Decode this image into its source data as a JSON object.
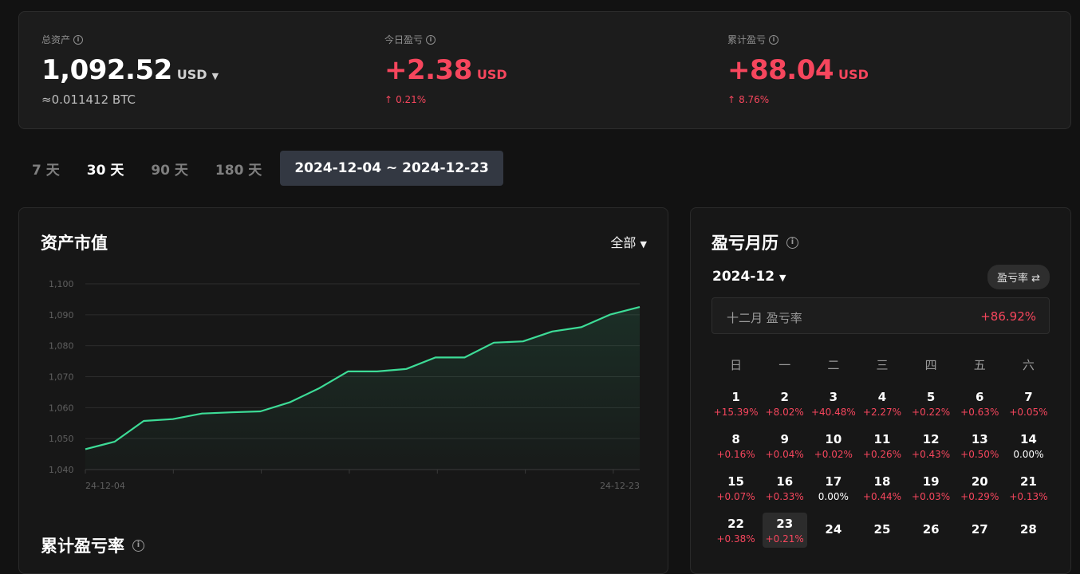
{
  "summary": {
    "total": {
      "label": "总资产",
      "value": "1,092.52",
      "unit": "USD",
      "btc": "≈0.011412 BTC"
    },
    "today": {
      "label": "今日盈亏",
      "value": "+2.38",
      "unit": "USD",
      "pct": "0.21%"
    },
    "cumulative": {
      "label": "累计盈亏",
      "value": "+88.04",
      "unit": "USD",
      "pct": "8.76%"
    }
  },
  "ranges": [
    "7 天",
    "30 天",
    "90 天",
    "180 天"
  ],
  "date_range": "2024-12-04 ~ 2024-12-23",
  "asset_panel": {
    "title": "资产市值",
    "filter": "全部"
  },
  "pnl_rate_panel": {
    "title": "累计盈亏率"
  },
  "chart_data": {
    "type": "area",
    "x_start_label": "24-12-04",
    "x_end_label": "24-12-23",
    "y_ticks": [
      "1,100",
      "1,090",
      "1,080",
      "1,070",
      "1,060",
      "1,050",
      "1,040"
    ],
    "ylim": [
      1040,
      1100
    ],
    "x": [
      "24-12-04",
      "24-12-05",
      "24-12-06",
      "24-12-07",
      "24-12-08",
      "24-12-09",
      "24-12-10",
      "24-12-11",
      "24-12-12",
      "24-12-13",
      "24-12-14",
      "24-12-15",
      "24-12-16",
      "24-12-17",
      "24-12-18",
      "24-12-19",
      "24-12-20",
      "24-12-21",
      "24-12-22",
      "24-12-23"
    ],
    "values": [
      1046.6,
      1049.0,
      1055.7,
      1056.3,
      1058.1,
      1058.5,
      1058.8,
      1061.7,
      1066.2,
      1071.7,
      1071.7,
      1072.5,
      1076.2,
      1076.2,
      1081.0,
      1081.4,
      1084.6,
      1086.0,
      1090.1,
      1092.5
    ],
    "line_color": "#3ddc97"
  },
  "calendar": {
    "title": "盈亏月历",
    "month": "2024-12",
    "toggle": "盈亏率",
    "month_label": "十二月 盈亏率",
    "month_value": "+86.92%",
    "weekdays": [
      "日",
      "一",
      "二",
      "三",
      "四",
      "五",
      "六"
    ],
    "days": [
      {
        "d": "1",
        "p": "+15.39%"
      },
      {
        "d": "2",
        "p": "+8.02%"
      },
      {
        "d": "3",
        "p": "+40.48%"
      },
      {
        "d": "4",
        "p": "+2.27%"
      },
      {
        "d": "5",
        "p": "+0.22%"
      },
      {
        "d": "6",
        "p": "+0.63%"
      },
      {
        "d": "7",
        "p": "+0.05%"
      },
      {
        "d": "8",
        "p": "+0.16%"
      },
      {
        "d": "9",
        "p": "+0.04%"
      },
      {
        "d": "10",
        "p": "+0.02%"
      },
      {
        "d": "11",
        "p": "+0.26%"
      },
      {
        "d": "12",
        "p": "+0.43%"
      },
      {
        "d": "13",
        "p": "+0.50%"
      },
      {
        "d": "14",
        "p": "0.00%"
      },
      {
        "d": "15",
        "p": "+0.07%"
      },
      {
        "d": "16",
        "p": "+0.33%"
      },
      {
        "d": "17",
        "p": "0.00%"
      },
      {
        "d": "18",
        "p": "+0.44%"
      },
      {
        "d": "19",
        "p": "+0.03%"
      },
      {
        "d": "20",
        "p": "+0.29%"
      },
      {
        "d": "21",
        "p": "+0.13%"
      },
      {
        "d": "22",
        "p": "+0.38%"
      },
      {
        "d": "23",
        "p": "+0.21%",
        "today": true
      },
      {
        "d": "24",
        "p": ""
      },
      {
        "d": "25",
        "p": ""
      },
      {
        "d": "26",
        "p": ""
      },
      {
        "d": "27",
        "p": ""
      },
      {
        "d": "28",
        "p": ""
      }
    ]
  },
  "colors": {
    "up": "#f6465d",
    "accent": "#3ddc97",
    "bg": "#121212"
  }
}
